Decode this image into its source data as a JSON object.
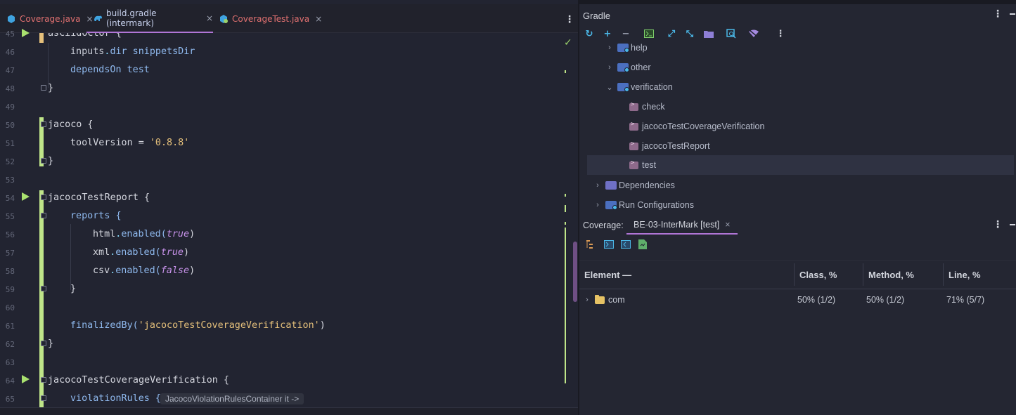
{
  "editor": {
    "tabs": [
      {
        "label": "Coverage.java",
        "color": "#e06c6c",
        "icon": "java-class-icon"
      },
      {
        "label": "build.gradle (intermark)",
        "color": "#b7c4e8",
        "icon": "gradle-elephant-icon"
      },
      {
        "label": "CoverageTest.java",
        "color": "#e06c6c",
        "icon": "java-test-class-icon"
      }
    ],
    "tab_close": "×",
    "more": "⋮",
    "line_numbers": [
      "45",
      "46",
      "47",
      "48",
      "49",
      "50",
      "51",
      "52",
      "53",
      "54",
      "55",
      "56",
      "57",
      "58",
      "59",
      "60",
      "61",
      "62",
      "63",
      "64",
      "65"
    ],
    "lines": {
      "l45": "asciidoctor {",
      "l46_a": "inputs",
      "l46_b": ".",
      "l46_c": "dir",
      "l46_d": " snippetsDir",
      "l47_a": "dependsOn",
      "l47_b": " test",
      "l48": "}",
      "l50": "jacoco {",
      "l51_a": "toolVersion",
      "l51_b": " = ",
      "l51_c": "'0.8.8'",
      "l52": "}",
      "l54": "jacocoTestReport {",
      "l55": "reports {",
      "l56_a": "html",
      "l56_b": ".",
      "l56_c": "enabled(",
      "l56_d": "true",
      "l56_e": ")",
      "l57_a": "xml",
      "l57_b": ".",
      "l57_c": "enabled(",
      "l57_d": "true",
      "l57_e": ")",
      "l58_a": "csv",
      "l58_b": ".",
      "l58_c": "enabled(",
      "l58_d": "false",
      "l58_e": ")",
      "l59": "}",
      "l61_a": "finalizedBy(",
      "l61_b": "'jacocoTestCoverageVerification'",
      "l61_c": ")",
      "l62": "}",
      "l64": "jacocoTestCoverageVerification {",
      "l65": "violationRules {"
    },
    "inlay_hint": "JacocoViolationRulesContainer it ->"
  },
  "gradle": {
    "title": "Gradle",
    "toolbar": [
      "refresh-icon",
      "add-icon",
      "remove-icon",
      "execute-task-icon",
      "expand-all-icon",
      "collapse-all-icon",
      "group-modules-icon",
      "analyze-dependencies-icon",
      "toggle-offline-icon",
      "more-options-icon"
    ],
    "tree": [
      {
        "label": "help",
        "kind": "task-group",
        "expanded": false
      },
      {
        "label": "other",
        "kind": "task-group",
        "expanded": false
      },
      {
        "label": "verification",
        "kind": "task-group",
        "expanded": true
      },
      {
        "label": "check",
        "kind": "task"
      },
      {
        "label": "jacocoTestCoverageVerification",
        "kind": "task"
      },
      {
        "label": "jacocoTestReport",
        "kind": "task"
      },
      {
        "label": "test",
        "kind": "task",
        "selected": true
      },
      {
        "label": "Dependencies",
        "kind": "folder",
        "expanded": false
      },
      {
        "label": "Run Configurations",
        "kind": "folder",
        "expanded": false
      }
    ]
  },
  "coverage": {
    "label": "Coverage:",
    "tab": "BE-03-InterMark [test]",
    "toolbar": [
      "flatten-packages-icon",
      "navigate-from-source-icon",
      "navigate-to-source-icon",
      "generate-report-icon"
    ],
    "columns": [
      "Element —",
      "Class, %",
      "Method, %",
      "Line, %"
    ],
    "rows": [
      {
        "element": "com",
        "class": "50% (1/2)",
        "method": "50% (1/2)",
        "line": "71% (5/7)"
      }
    ]
  },
  "colors": {
    "accent": "#b075d6",
    "covered": "#bfe589",
    "partial": "#e5c07b",
    "run": "#a9e16f",
    "folder_blue": "#4b6fc0",
    "folder_yellow": "#e6c264"
  }
}
